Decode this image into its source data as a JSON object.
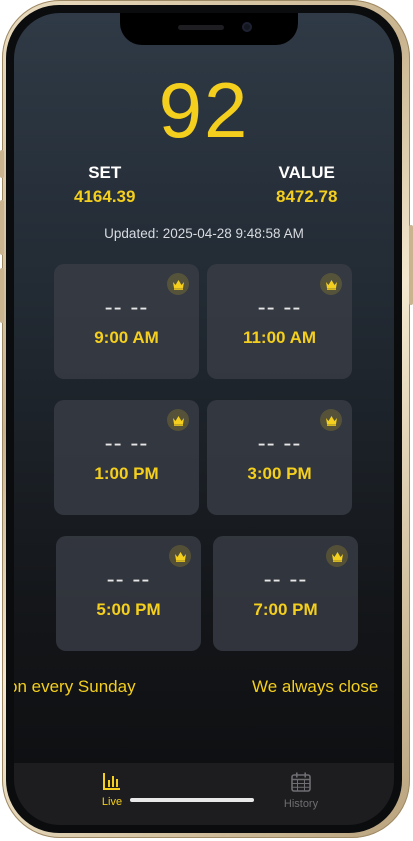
{
  "header": {
    "score": "92"
  },
  "stats": {
    "set_label": "SET",
    "set_value": "4164.39",
    "value_label": "VALUE",
    "value_value": "8472.78"
  },
  "updated_text": "Updated: 2025-04-28 9:48:58 AM",
  "slots": [
    {
      "result": "-- --",
      "time": "9:00 AM",
      "icon": "crown-icon"
    },
    {
      "result": "-- --",
      "time": "11:00 AM",
      "icon": "crown-icon"
    },
    {
      "result": "-- --",
      "time": "1:00 PM",
      "icon": "crown-icon"
    },
    {
      "result": "-- --",
      "time": "3:00 PM",
      "icon": "crown-icon"
    },
    {
      "result": "-- --",
      "time": "5:00 PM",
      "icon": "crown-icon"
    },
    {
      "result": "-- --",
      "time": "7:00 PM",
      "icon": "crown-icon"
    }
  ],
  "ticker": {
    "left_text": "on every Sunday",
    "right_text": "We always close"
  },
  "tabs": [
    {
      "label": "Live",
      "icon": "bar-chart-icon",
      "active": true
    },
    {
      "label": "History",
      "icon": "calendar-icon",
      "active": false
    }
  ],
  "colors": {
    "accent": "#f4cf1d",
    "inactive_tab": "#6e6e73",
    "tabbar_bg": "#1d1d1f"
  }
}
